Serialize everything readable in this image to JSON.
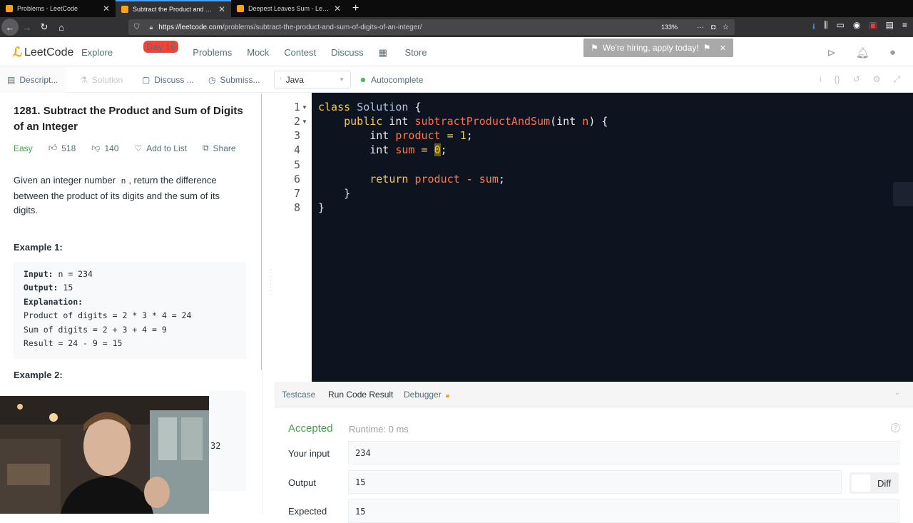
{
  "browser": {
    "tabs": [
      {
        "title": "Problems - LeetCode",
        "active": false
      },
      {
        "title": "Subtract the Product and Sum",
        "active": true
      },
      {
        "title": "Deepest Leaves Sum - LeetCo",
        "active": false
      }
    ],
    "new_tab": "+",
    "url_host": "https://leetcode.com",
    "url_path": "/problems/subtract-the-product-and-sum-of-digits-of-an-integer/",
    "zoom": "133%"
  },
  "nav": {
    "logo": "LeetCode",
    "explore": "Explore",
    "day_badge": "Day 16",
    "problems": "Problems",
    "mock": "Mock",
    "contest": "Contest",
    "discuss": "Discuss",
    "store": "Store",
    "hiring": "We're hiring, apply today!"
  },
  "subtabs": {
    "description": "Descript...",
    "solution": "Solution",
    "discuss": "Discuss ...",
    "submissions": "Submiss...",
    "language": "Java",
    "autocomplete": "Autocomplete"
  },
  "problem": {
    "title": "1281. Subtract the Product and Sum of Digits of an Integer",
    "difficulty": "Easy",
    "likes": "518",
    "dislikes": "140",
    "add_to_list": "Add to List",
    "share": "Share",
    "desc_before": "Given an integer number ",
    "desc_code": "n",
    "desc_after": ", return the difference between the product of its digits and the sum of its digits.",
    "example1_heading": "Example 1:",
    "example1": {
      "input_label": "Input:",
      "input_value": " n = 234",
      "output_label": "Output:",
      "output_value": " 15",
      "explanation_label": "Explanation:",
      "line1": "Product of digits = 2 * 3 * 4 = 24",
      "line2": "Sum of digits = 2 + 3 + 4 = 9",
      "line3": "Result = 24 - 9 = 15"
    },
    "example2_heading": "Example 2:",
    "example2_partial": "32"
  },
  "editor": {
    "line_numbers": [
      "1",
      "2",
      "3",
      "4",
      "5",
      "6",
      "7",
      "8"
    ]
  },
  "result": {
    "tab_testcase": "Testcase",
    "tab_run": "Run Code Result",
    "tab_debugger": "Debugger",
    "status": "Accepted",
    "runtime": "Runtime: 0 ms",
    "your_input_label": "Your input",
    "your_input": "234",
    "output_label": "Output",
    "output": "15",
    "expected_label": "Expected",
    "expected": "15",
    "diff": "Diff"
  },
  "colors": {
    "accent": "#ffa116",
    "accepted": "#43a047",
    "editor_bg": "#0e1320"
  }
}
